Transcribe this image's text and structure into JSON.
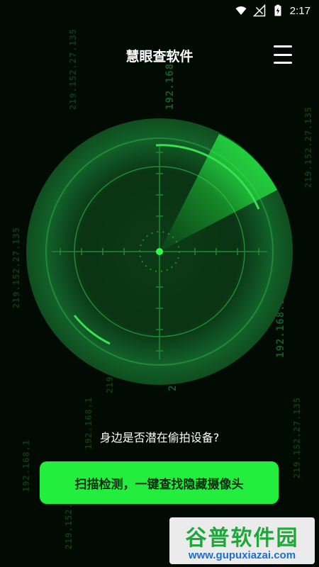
{
  "status_bar": {
    "time": "2:17",
    "icons": [
      "wifi-icon",
      "signal-icon",
      "battery-charging-icon"
    ]
  },
  "header": {
    "title": "慧眼查软件",
    "menu_icon": "menu-icon"
  },
  "background": {
    "ip_text": [
      "219.152.27.135",
      "192.168.1",
      "219.152.27.135",
      "192.168.1",
      "219.152.27.135",
      "219.152.27.135",
      "192.168.1"
    ]
  },
  "main": {
    "question": "身边是否潜在偷拍设备?",
    "scan_button_label": "扫描检测，一键查找隐藏摄像头"
  },
  "watermark": {
    "title": "谷普软件园",
    "url": "www.gupuxiazai.com"
  },
  "colors": {
    "accent": "#23ee3e",
    "background": "#020a04",
    "radar": "#1fd13a"
  }
}
